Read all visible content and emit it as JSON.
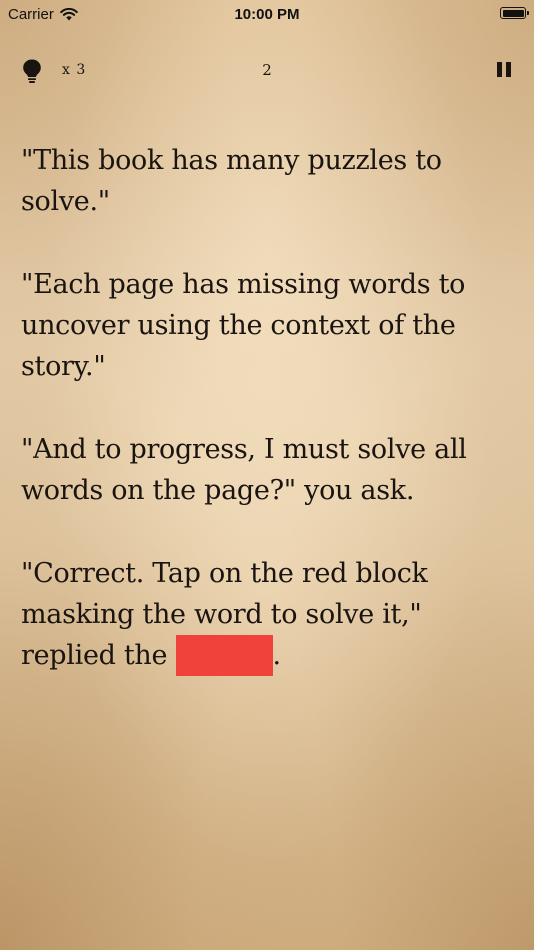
{
  "status_bar": {
    "carrier": "Carrier",
    "time": "10:00 PM",
    "battery_level": 1.0
  },
  "toolbar": {
    "hint_icon": "lightbulb-icon",
    "hint_count": "x 3",
    "page_number": "2",
    "pause_icon": "pause-icon"
  },
  "story": {
    "paragraphs": [
      "\"This book has many puzzles to solve.\"",
      "\"Each page has missing words to uncover using the context of the story.\"",
      "\"And to progress, I must solve all words on the page?\" you ask."
    ],
    "last_paragraph_before": "\"Correct. Tap on the red block masking the word to solve it,\" replied the ",
    "last_paragraph_after": "."
  },
  "colors": {
    "mask": "#f0423a",
    "text": "#1a1410",
    "paper": "#e6cba3"
  }
}
